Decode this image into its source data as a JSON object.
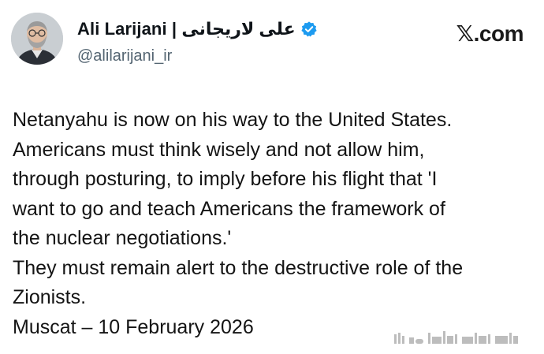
{
  "author": {
    "display_name": "Ali Larijani | علی لاریجانی",
    "handle": "@alilarijani_ir",
    "verified": true
  },
  "brand": {
    "label": "𝕏.com"
  },
  "tweet": {
    "lines": [
      "Netanyahu is now on his way to the United States.",
      "Americans must think wisely and not allow him,",
      "through posturing, to imply before his flight that 'I",
      "want to go and teach Americans the framework of",
      "the nuclear negotiations.'",
      "They must remain alert to the destructive role of the",
      "Zionists.",
      "Muscat – 10 February 2026"
    ]
  },
  "colors": {
    "verified_badge": "#1d9bf0",
    "handle_text": "#536471",
    "body_text": "#141414"
  },
  "icons": {
    "verified": "verified-badge-icon",
    "avatar": "profile-avatar"
  }
}
